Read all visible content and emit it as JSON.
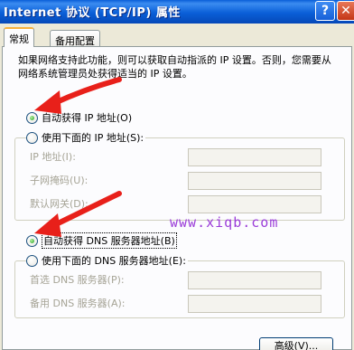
{
  "window": {
    "title": "Internet 协议 (TCP/IP) 属性",
    "help_icon": "?",
    "close_icon": "✕"
  },
  "tabs": [
    {
      "label": "常规",
      "selected": true
    },
    {
      "label": "备用配置",
      "selected": false
    }
  ],
  "description": "如果网络支持此功能，则可以获取自动指派的 IP 设置。否则，您需要从网络系统管理员处获得适当的 IP 设置。",
  "ip": {
    "auto_label": "自动获得 IP 地址(O)",
    "auto_selected": true,
    "manual_label": "使用下面的 IP 地址(S):",
    "manual_selected": false,
    "fields": [
      {
        "label": "IP 地址(I):",
        "value": ""
      },
      {
        "label": "子网掩码(U):",
        "value": ""
      },
      {
        "label": "默认网关(D):",
        "value": ""
      }
    ]
  },
  "dns": {
    "auto_label": "自动获得 DNS 服务器地址(B)",
    "auto_selected": true,
    "manual_label": "使用下面的 DNS 服务器地址(E):",
    "manual_selected": false,
    "fields": [
      {
        "label": "首选 DNS 服务器(P):",
        "value": ""
      },
      {
        "label": "备用 DNS 服务器(A):",
        "value": ""
      }
    ]
  },
  "watermark": "www.xiqb.com",
  "advanced_button": "高级(V)...",
  "colors": {
    "title_bar": "#0a5fd8",
    "arrow": "#e8201a",
    "watermark": "#9a3bd8"
  }
}
